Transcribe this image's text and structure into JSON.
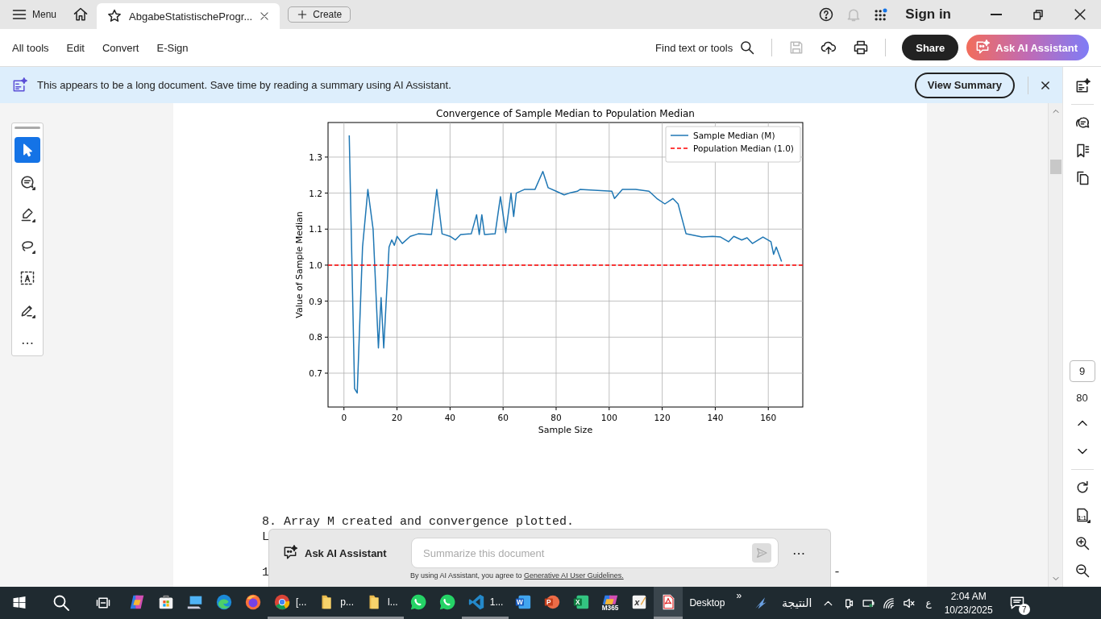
{
  "app_bar": {
    "menu_label": "Menu",
    "tabs": [
      {
        "title": "AbgabeStatistischeProgr...",
        "selected": true
      }
    ],
    "create_label": "Create",
    "notifications_disabled": true,
    "sign_in": "Sign in"
  },
  "toolbar": {
    "menu_items": [
      "All tools",
      "Edit",
      "Convert",
      "E-Sign"
    ],
    "find_label": "Find text or tools",
    "save_disabled": true,
    "share_label": "Share",
    "ai_label": "Ask AI Assistant"
  },
  "banner": {
    "message": "This appears to be a long document. Save time by reading a summary using AI Assistant.",
    "action": "View Summary"
  },
  "tools": [
    {
      "kind": "cursor",
      "selected": true
    },
    {
      "kind": "comment",
      "selected": false
    },
    {
      "kind": "highlight",
      "selected": false
    },
    {
      "kind": "lasso",
      "selected": false
    },
    {
      "kind": "textsel",
      "selected": false
    },
    {
      "kind": "sign",
      "selected": false
    },
    {
      "kind": "more",
      "label": "⋯",
      "selected": false
    }
  ],
  "document": {
    "chart_data": {
      "type": "line",
      "title": "Convergence of Sample Median to Population Median",
      "xlabel": "Sample Size",
      "ylabel": "Value of Sample Median",
      "x": [
        -6,
        2,
        4,
        5,
        7,
        9,
        11,
        13,
        14,
        15,
        17,
        18,
        19,
        20,
        22,
        25,
        28,
        33,
        35,
        37,
        40,
        42,
        44,
        48,
        50,
        51,
        52,
        53,
        57,
        59,
        61,
        63,
        64,
        65,
        68,
        72,
        75,
        77,
        80,
        83,
        85,
        88,
        89,
        101,
        102,
        105,
        110,
        115,
        118,
        121,
        124,
        126,
        129,
        135,
        139,
        142,
        145,
        147,
        150,
        152,
        154,
        158,
        161,
        162,
        163,
        165,
        173
      ],
      "series": [
        {
          "name": "Sample Median (M)",
          "color": "#1f77b4",
          "line_style": "solid",
          "values": [
            null,
            1.36,
            0.657,
            0.645,
            1.05,
            1.21,
            1.1,
            0.77,
            0.91,
            0.77,
            1.05,
            1.07,
            1.055,
            1.08,
            1.06,
            1.08,
            1.087,
            1.085,
            1.21,
            1.087,
            1.08,
            1.07,
            1.085,
            1.087,
            1.14,
            1.085,
            1.14,
            1.085,
            1.087,
            1.19,
            1.09,
            1.2,
            1.135,
            1.2,
            1.21,
            1.21,
            1.26,
            1.215,
            1.205,
            1.195,
            1.2,
            1.205,
            1.21,
            1.205,
            1.185,
            1.21,
            1.21,
            1.205,
            1.185,
            1.17,
            1.185,
            1.17,
            1.087,
            1.078,
            1.08,
            1.078,
            1.065,
            1.08,
            1.07,
            1.076,
            1.06,
            1.078,
            1.065,
            1.03,
            1.05,
            1.01,
            null
          ]
        },
        {
          "name": "Population Median (1.0)",
          "color": "#ff0000",
          "line_style": "dashed",
          "values": [
            1,
            1,
            1,
            1,
            1,
            1,
            1,
            1,
            1,
            1,
            1,
            1,
            1,
            1,
            1,
            1,
            1,
            1,
            1,
            1,
            1,
            1,
            1,
            1,
            1,
            1,
            1,
            1,
            1,
            1,
            1,
            1,
            1,
            1,
            1,
            1,
            1,
            1,
            1,
            1,
            1,
            1,
            1,
            1,
            1,
            1,
            1,
            1,
            1,
            1,
            1,
            1,
            1,
            1,
            1,
            1,
            1,
            1,
            1,
            1,
            1,
            1,
            1,
            1,
            1,
            1,
            1
          ]
        }
      ],
      "xlim": [
        -6,
        173
      ],
      "ylim": [
        0.606,
        1.396
      ],
      "xticks": [
        0,
        20,
        40,
        60,
        80,
        100,
        120,
        140,
        160
      ],
      "yticks": [
        {
          "value": 0.7,
          "label": "0.7"
        },
        {
          "value": 0.8,
          "label": "0.8"
        },
        {
          "value": 0.9,
          "label": "0.9"
        },
        {
          "value": 1,
          "label": "1.0"
        },
        {
          "value": 1.1,
          "label": "1.1"
        },
        {
          "value": 1.2,
          "label": "1.2"
        },
        {
          "value": 1.3,
          "label": "1.3"
        }
      ],
      "grid": true,
      "legend": true
    },
    "paragraphs": [
      {
        "lines": [
          "8. Array M created and convergence plotted.",
          "L"
        ]
      },
      {
        "lines": [
          "1"
        ],
        "trailing": "-"
      }
    ]
  },
  "ai_panel": {
    "title": "Ask AI Assistant",
    "placeholder": "Summarize this document",
    "more": "⋯",
    "notice": "By using AI Assistant, you agree to",
    "link": "Generative AI User Guidelines."
  },
  "right_rail": {
    "page_number": "9",
    "page_count": "80",
    "fit_label": "1:1"
  },
  "taskbar": {
    "apps": [
      {
        "kind": "copilot",
        "running": false
      },
      {
        "kind": "store",
        "running": false
      },
      {
        "kind": "computer",
        "running": false
      },
      {
        "kind": "edge",
        "running": false
      },
      {
        "kind": "firefox",
        "running": false
      },
      {
        "kind": "chrome",
        "running": true,
        "label": "[..."
      },
      {
        "kind": "folder",
        "running": true,
        "label": "p..."
      },
      {
        "kind": "folder",
        "running": true,
        "label": "l..."
      },
      {
        "kind": "whatsapp",
        "running": false
      },
      {
        "kind": "whatsapp",
        "running": false
      },
      {
        "kind": "vscode",
        "running": true,
        "label": "1..."
      },
      {
        "kind": "word",
        "running": false,
        "glyph": "W"
      },
      {
        "kind": "ppt",
        "running": false,
        "glyph": "P"
      },
      {
        "kind": "excel",
        "running": false,
        "glyph": "X"
      },
      {
        "kind": "m365",
        "running": false,
        "glyph": "M365"
      },
      {
        "kind": "formula",
        "running": false,
        "glyph": "x"
      },
      {
        "kind": "pdf",
        "running": true,
        "selected": true
      }
    ],
    "desktop": "Desktop",
    "overflow": "»",
    "widget": "النتيجة",
    "lang": "ع",
    "time": "2:04 AM",
    "date": "10/23/2025",
    "notifications": "7"
  }
}
